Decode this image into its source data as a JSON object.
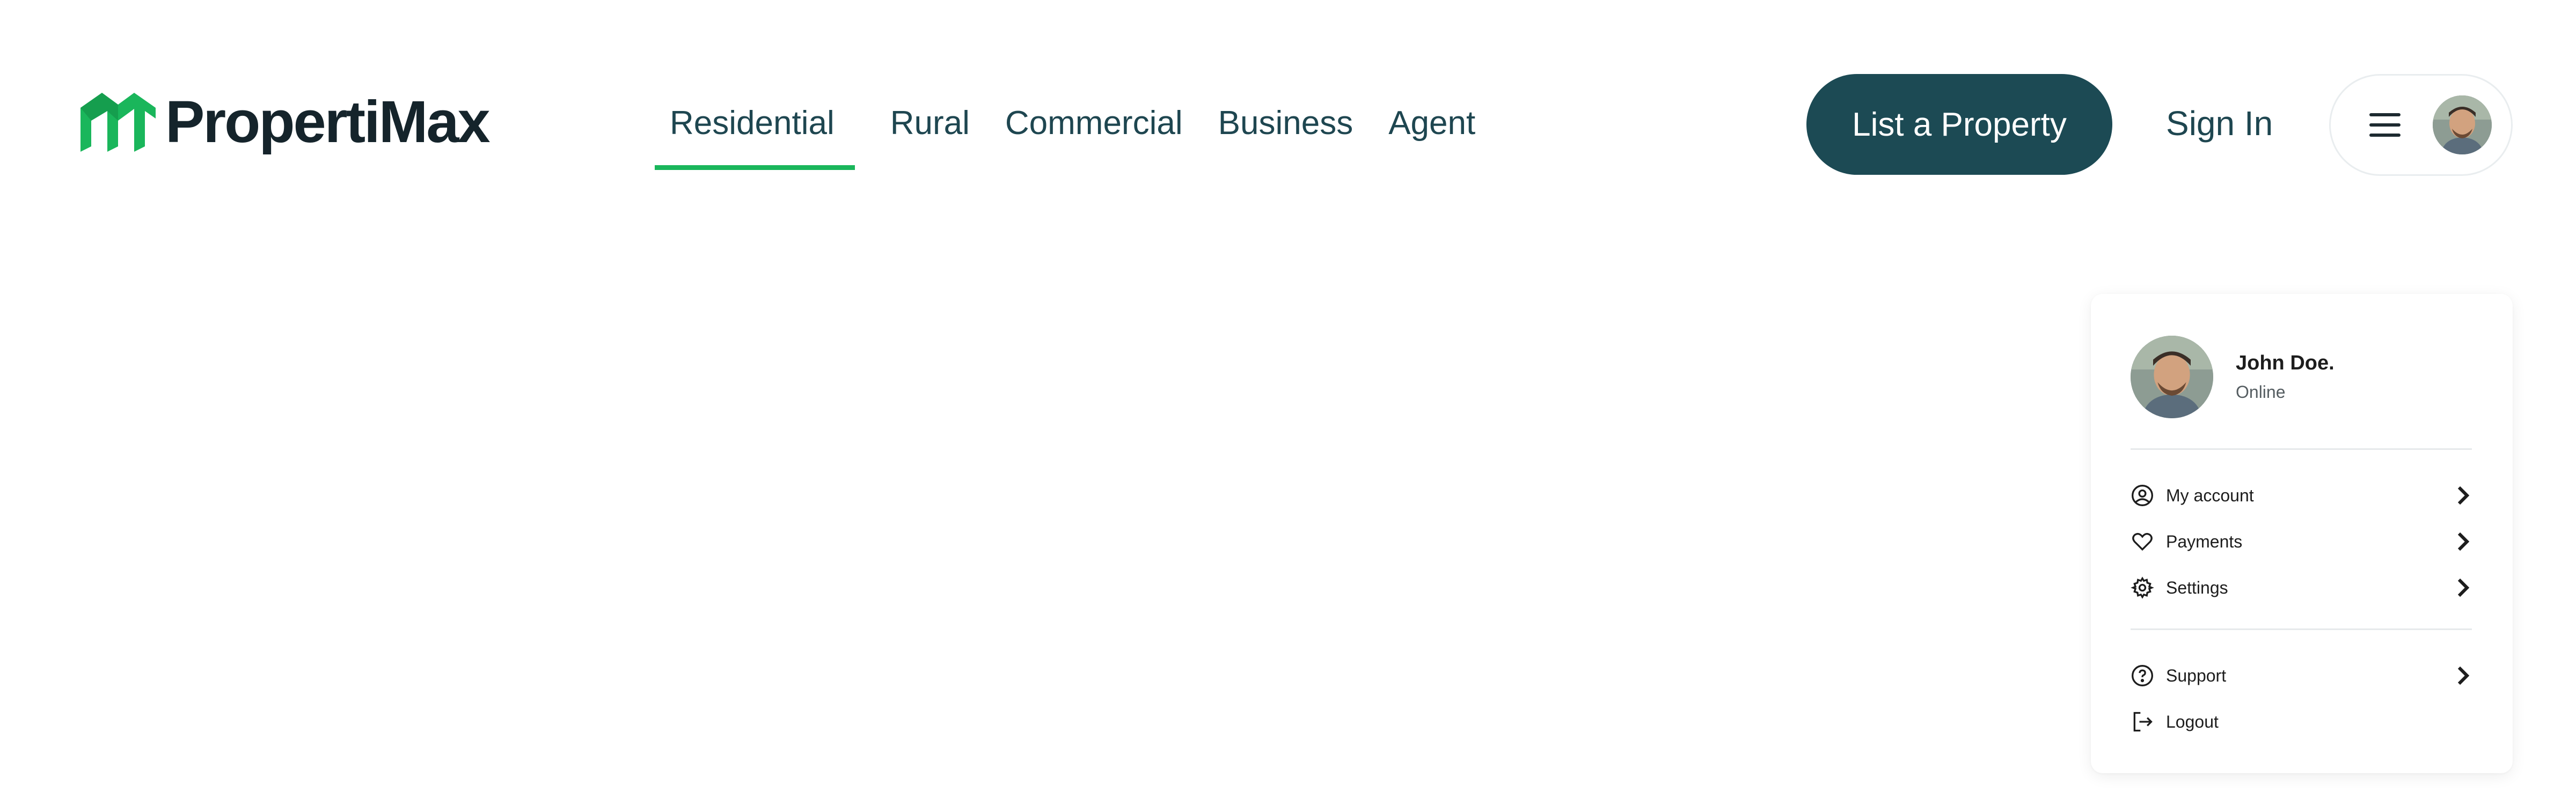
{
  "brand": {
    "name": "PropertiMax",
    "accent": "#1ab65b",
    "primary": "#1c4a54"
  },
  "nav": {
    "items": [
      {
        "label": "Residential",
        "active": true
      },
      {
        "label": "Rural",
        "active": false
      },
      {
        "label": "Commercial",
        "active": false
      },
      {
        "label": "Business",
        "active": false
      },
      {
        "label": "Agent",
        "active": false
      }
    ]
  },
  "header": {
    "list_property_label": "List a Property",
    "sign_in_label": "Sign In",
    "menu_icon": "hamburger-icon",
    "avatar_icon": "user-avatar"
  },
  "dropdown": {
    "user": {
      "name": "John Doe.",
      "status": "Online"
    },
    "items": [
      {
        "label": "My account",
        "icon": "user-circle-icon"
      },
      {
        "label": "Payments",
        "icon": "heart-icon"
      },
      {
        "label": "Settings",
        "icon": "gear-icon"
      },
      {
        "label": "Support",
        "icon": "help-circle-icon"
      },
      {
        "label": "Logout",
        "icon": "logout-icon"
      }
    ]
  }
}
